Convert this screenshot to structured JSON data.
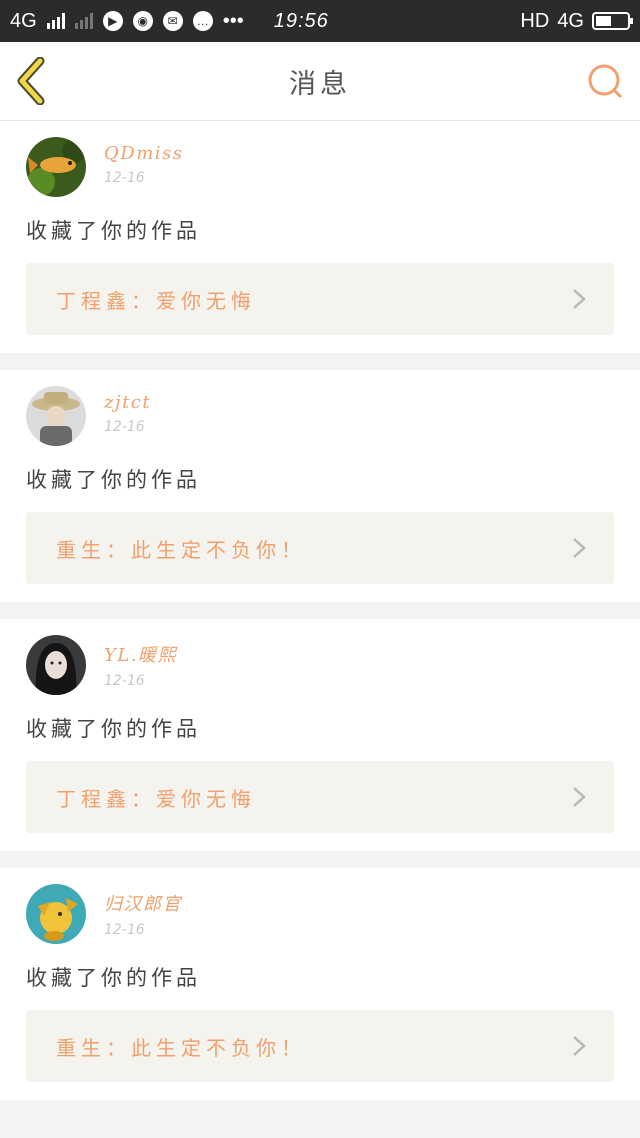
{
  "status_bar": {
    "network_left": "4G",
    "time": "19:56",
    "hd_label": "HD",
    "network_right": "4G",
    "battery_level_percent": 50
  },
  "header": {
    "title": "消息",
    "accent_color": "#f0a06c"
  },
  "messages": [
    {
      "username": "QDmiss",
      "date": "12-16",
      "action": "收藏了你的作品",
      "work_title": "丁程鑫：爱你无悔",
      "avatar": "goldfish-avatar"
    },
    {
      "username": "zjtct",
      "date": "12-16",
      "action": "收藏了你的作品",
      "work_title": "重生：此生定不负你！",
      "avatar": "hat-person-avatar"
    },
    {
      "username": "YL.暖熙",
      "date": "12-16",
      "action": "收藏了你的作品",
      "work_title": "丁程鑫：爱你无悔",
      "avatar": "girl-avatar"
    },
    {
      "username": "归汉郎官",
      "date": "12-16",
      "action": "收藏了你的作品",
      "work_title": "重生：此生定不负你！",
      "avatar": "yellow-dragon-avatar"
    }
  ]
}
